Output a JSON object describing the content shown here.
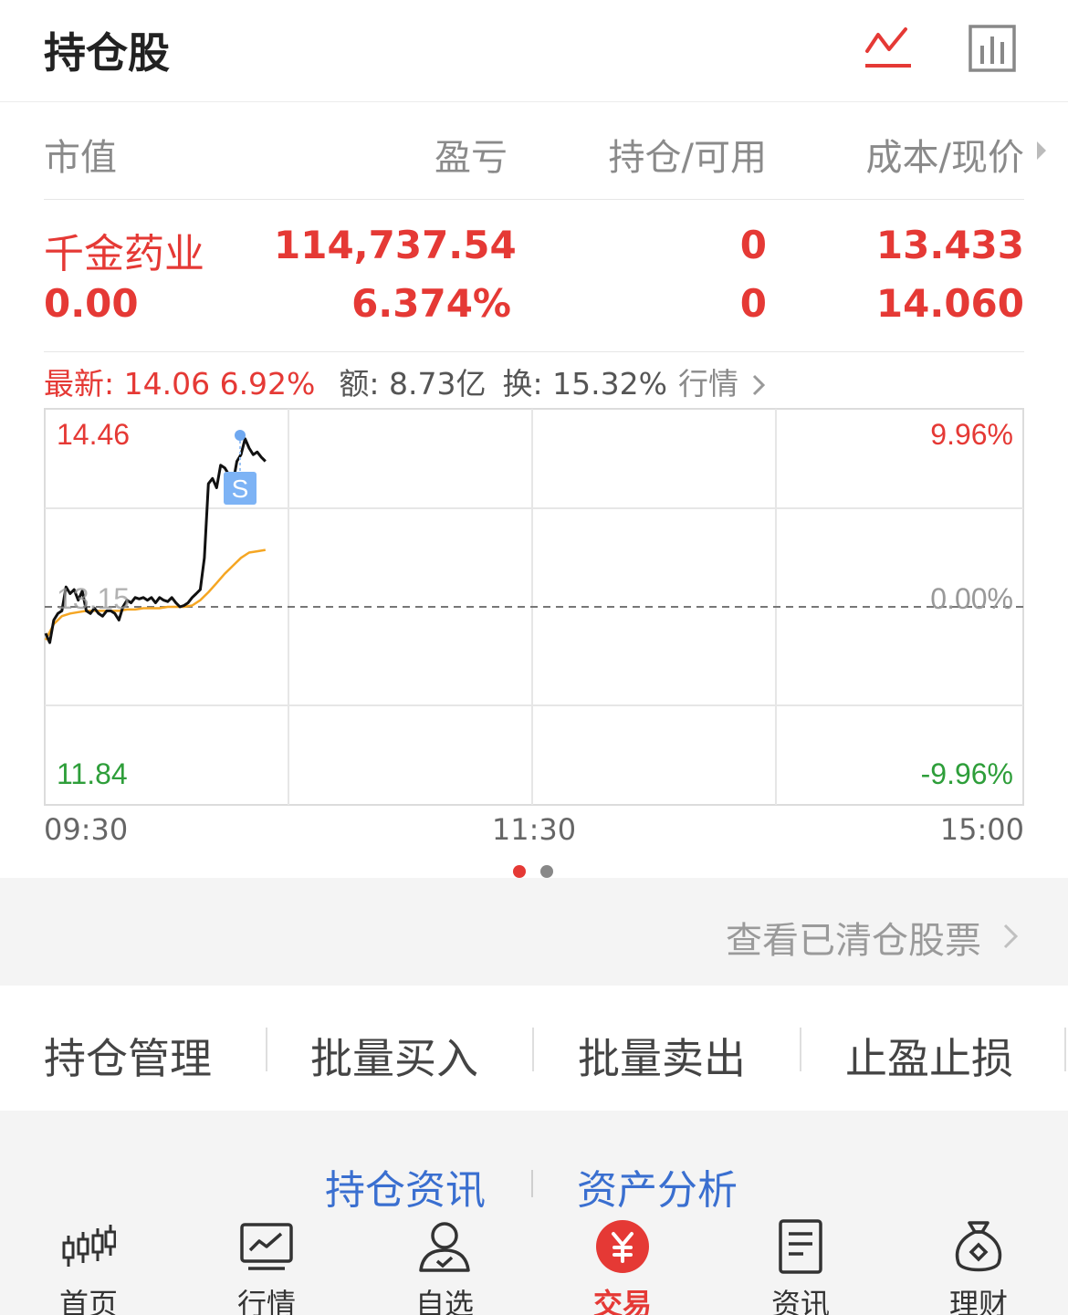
{
  "header": {
    "title": "持仓股"
  },
  "table_head": {
    "market_value": "市值",
    "pnl": "盈亏",
    "position": "持仓/可用",
    "cost": "成本/现价"
  },
  "holding": {
    "name": "千金药业",
    "market_value": "0.00",
    "pnl": "114,737.54",
    "pnl_pct": "6.374%",
    "position": "0",
    "available": "0",
    "cost": "13.433",
    "price": "14.060"
  },
  "quote": {
    "latest": "最新: 14.06 6.92%",
    "amount": "额: 8.73亿",
    "turnover": "换: 15.32%",
    "market_link": "行情"
  },
  "chart_data": {
    "type": "line",
    "y_high": "14.46",
    "y_mid": "13.15",
    "y_low": "11.84",
    "pct_high": "9.96%",
    "pct_mid": "0.00%",
    "pct_low": "-9.96%",
    "marker": "S",
    "x_ticks": [
      "09:30",
      "11:30",
      "15:00"
    ],
    "ylim": [
      11.84,
      14.46
    ],
    "total_minutes": 240,
    "series": [
      {
        "color": "#111111",
        "x": [
          0,
          1,
          2,
          3,
          4,
          5,
          6,
          7,
          8,
          9,
          10,
          11,
          12,
          13,
          14,
          15,
          16,
          17,
          18,
          19,
          20,
          21,
          22,
          23,
          24,
          25,
          26,
          27,
          28,
          29,
          30,
          31,
          32,
          33,
          34,
          35,
          36,
          37,
          38,
          39,
          40,
          41,
          42,
          43,
          44,
          45,
          46,
          47,
          48,
          49,
          50,
          51,
          52,
          53,
          54
        ],
        "values": [
          12.95,
          12.88,
          13.05,
          13.1,
          13.12,
          13.3,
          13.25,
          13.28,
          13.2,
          13.27,
          13.12,
          13.1,
          13.14,
          13.1,
          13.08,
          13.12,
          13.12,
          13.1,
          13.05,
          13.15,
          13.2,
          13.18,
          13.22,
          13.21,
          13.22,
          13.2,
          13.22,
          13.18,
          13.22,
          13.2,
          13.19,
          13.22,
          13.18,
          13.15,
          13.16,
          13.18,
          13.22,
          13.25,
          13.28,
          13.52,
          14.08,
          14.12,
          14.05,
          14.22,
          14.2,
          14.15,
          14.08,
          14.25,
          14.3,
          14.42,
          14.35,
          14.3,
          14.32,
          14.28,
          14.25
        ]
      },
      {
        "color": "#f5a623",
        "x": [
          0,
          2,
          4,
          6,
          8,
          10,
          12,
          14,
          16,
          18,
          20,
          22,
          24,
          26,
          28,
          30,
          32,
          34,
          36,
          38,
          40,
          42,
          44,
          46,
          48,
          50,
          52,
          54
        ],
        "values": [
          12.9,
          13.02,
          13.08,
          13.1,
          13.11,
          13.12,
          13.12,
          13.12,
          13.12,
          13.12,
          13.13,
          13.13,
          13.14,
          13.14,
          13.14,
          13.15,
          13.15,
          13.15,
          13.16,
          13.2,
          13.26,
          13.33,
          13.4,
          13.46,
          13.52,
          13.56,
          13.57,
          13.58
        ]
      }
    ]
  },
  "page_dots": {
    "active": "#e53935",
    "inactive": "#888888"
  },
  "cleared_link": "查看已清仓股票",
  "actions": [
    "持仓管理",
    "批量买入",
    "批量卖出",
    "止盈止损"
  ],
  "links": [
    "持仓资讯",
    "资产分析"
  ],
  "tabs": [
    {
      "label": "首页",
      "icon": "candlestick-icon"
    },
    {
      "label": "行情",
      "icon": "trend-chart-icon"
    },
    {
      "label": "自选",
      "icon": "user-check-icon"
    },
    {
      "label": "交易",
      "icon": "yuan-icon"
    },
    {
      "label": "资讯",
      "icon": "document-icon"
    },
    {
      "label": "理财",
      "icon": "money-bag-icon"
    }
  ],
  "colors": {
    "accent": "#e53935",
    "link": "#3a6fd0",
    "down": "#2e9e3a"
  }
}
